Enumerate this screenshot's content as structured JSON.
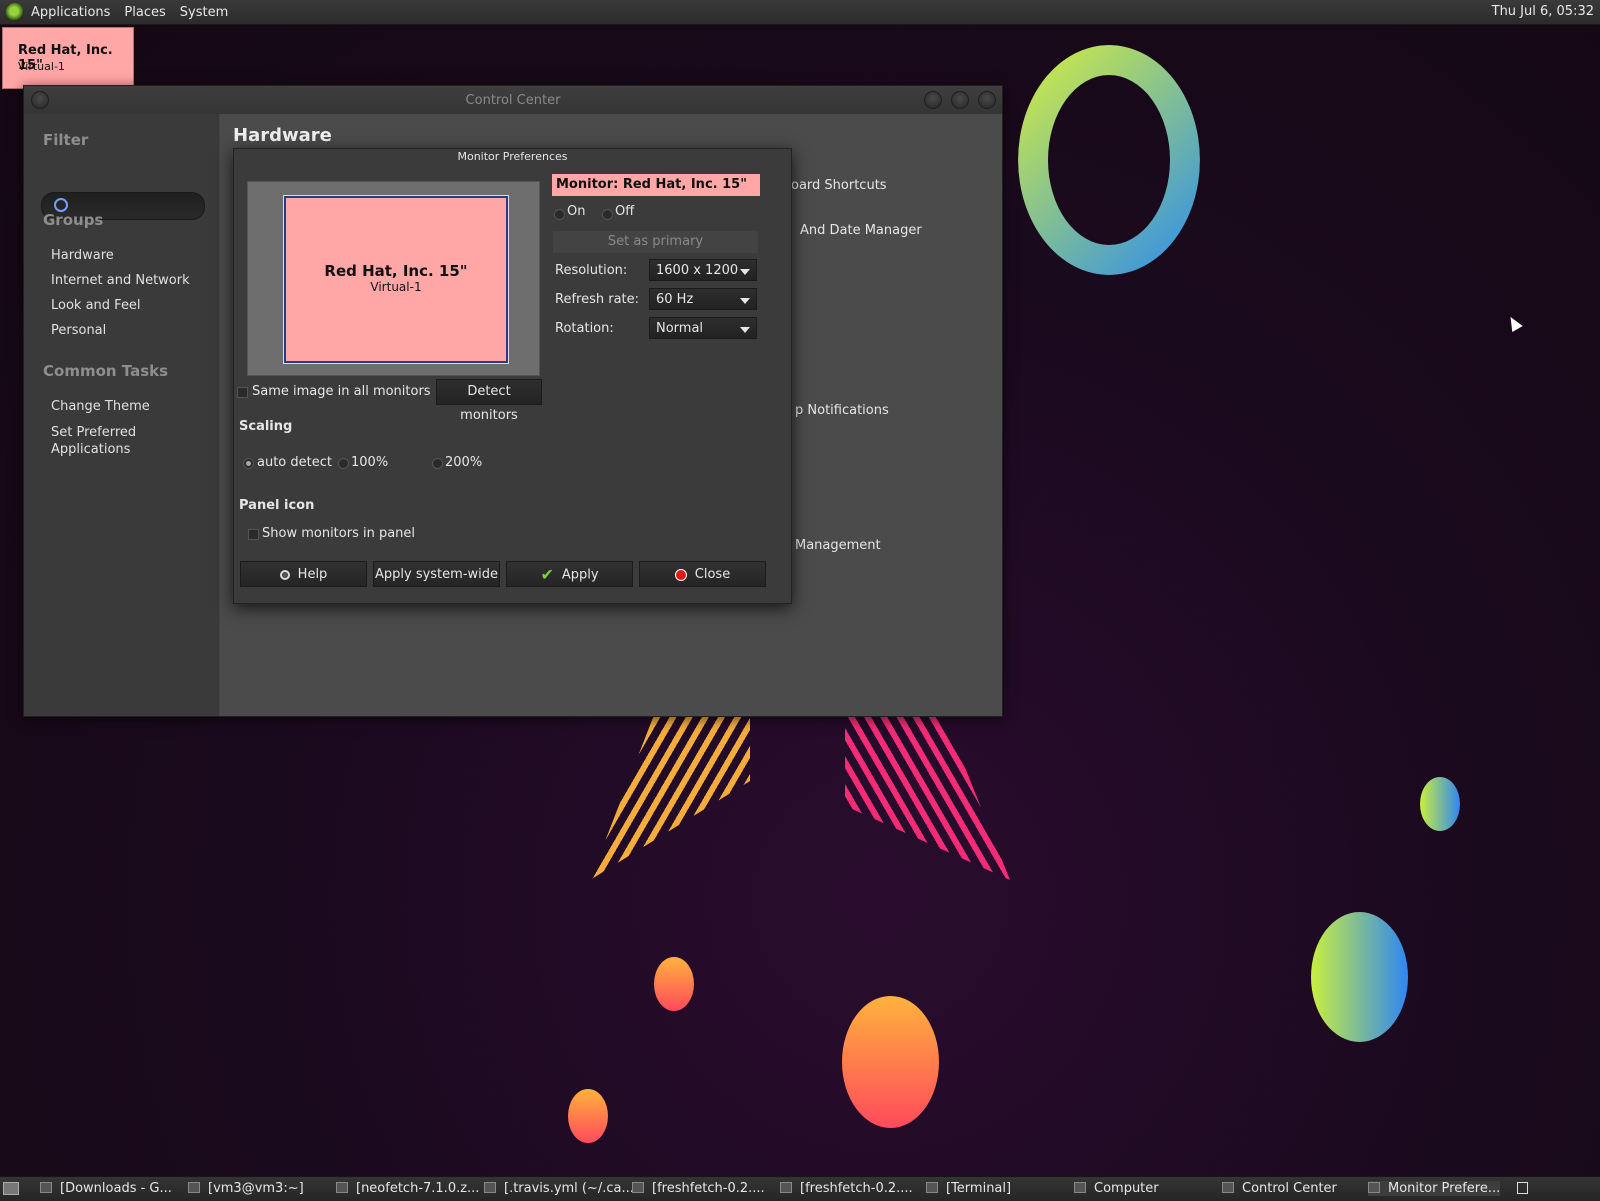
{
  "top_panel": {
    "menus": [
      "Applications",
      "Places",
      "System"
    ],
    "clock": "Thu Jul  6, 05:32"
  },
  "osd": {
    "title": "Red Hat, Inc. 15\"",
    "subtitle": "Virtual-1"
  },
  "control_center": {
    "title": "Control Center",
    "sidebar": {
      "filter_heading": "Filter",
      "groups_heading": "Groups",
      "groups": [
        "Hardware",
        "Internet and Network",
        "Look and Feel",
        "Personal"
      ],
      "tasks_heading": "Common Tasks",
      "tasks": [
        "Change Theme",
        "Set Preferred Applications"
      ]
    },
    "main": {
      "heading": "Hardware",
      "partial_items": [
        "oard Shortcuts",
        "And Date Manager",
        "p Notifications",
        "Management"
      ]
    }
  },
  "monitor_prefs": {
    "title": "Monitor Preferences",
    "preview": {
      "name": "Red Hat, Inc. 15\"",
      "port": "Virtual-1"
    },
    "monitor_label": "Monitor: Red Hat, Inc. 15\"",
    "on_label": "On",
    "off_label": "Off",
    "set_primary": "Set as primary",
    "resolution_label": "Resolution:",
    "resolution_value": "1600 x 1200",
    "refresh_label": "Refresh rate:",
    "refresh_value": "60 Hz",
    "rotation_label": "Rotation:",
    "rotation_value": "Normal",
    "same_image": "Same image in all monitors",
    "detect": "Detect monitors",
    "scaling_heading": "Scaling",
    "scaling_options": [
      "auto detect",
      "100%",
      "200%"
    ],
    "panel_heading": "Panel icon",
    "show_in_panel": "Show monitors in panel",
    "buttons": {
      "help": "Help",
      "apply_system": "Apply system-wide",
      "apply": "Apply",
      "close": "Close"
    }
  },
  "taskbar": {
    "tasks": [
      "[Downloads - G...",
      "[vm3@vm3:~]",
      "[neofetch-7.1.0.z...",
      "[.travis.yml (~/.ca...",
      "[freshfetch-0.2....",
      "[freshfetch-0.2....",
      "[Terminal]",
      "Computer",
      "Control Center",
      "Monitor Prefere..."
    ]
  }
}
